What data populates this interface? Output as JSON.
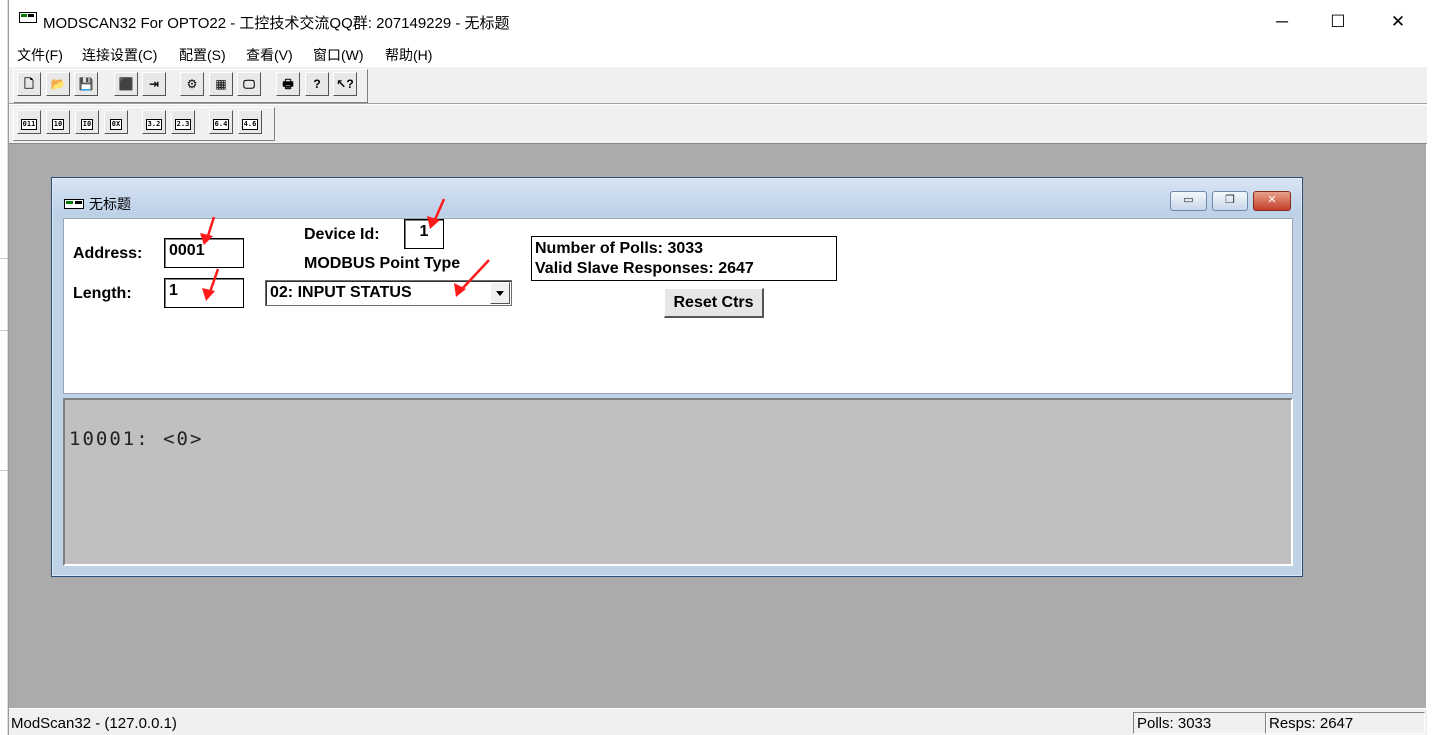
{
  "window": {
    "title": "MODSCAN32 For OPTO22 - 工控技术交流QQ群: 207149229 - 无标题",
    "minimize": "─",
    "maximize": "☐",
    "close": "✕"
  },
  "menu": [
    "文件(F)",
    "连接设置(C)",
    "配置(S)",
    "查看(V)",
    "窗口(W)",
    "帮助(H)"
  ],
  "toolbar1": [
    {
      "name": "new-file-icon",
      "glyph": "🗋"
    },
    {
      "name": "open-folder-icon",
      "glyph": "📂"
    },
    {
      "name": "save-icon",
      "glyph": "💾"
    },
    {
      "name": "connect-icon",
      "glyph": "⬛"
    },
    {
      "name": "disconnect-icon",
      "glyph": "⇥"
    },
    {
      "name": "data-definition-icon",
      "glyph": "⚙"
    },
    {
      "name": "display-icon",
      "glyph": "▦"
    },
    {
      "name": "monitor-icon",
      "glyph": "🖵"
    },
    {
      "name": "print-icon",
      "glyph": "🖶"
    },
    {
      "name": "help-icon",
      "glyph": "?"
    },
    {
      "name": "context-help-icon",
      "glyph": "↖?"
    }
  ],
  "toolbar2": [
    {
      "name": "binary-format-icon",
      "label": "011"
    },
    {
      "name": "decimal-format-icon",
      "label": "10"
    },
    {
      "name": "integer-format-icon",
      "label": "I0"
    },
    {
      "name": "hex-format-icon",
      "label": "0X"
    },
    {
      "name": "float-format-icon",
      "label": "3.2"
    },
    {
      "name": "float-swapped-format-icon",
      "label": "2.3"
    },
    {
      "name": "double-format-icon",
      "label": "6.4"
    },
    {
      "name": "double-swapped-format-icon",
      "label": "4.6"
    }
  ],
  "child": {
    "title": "无标题",
    "minimize": "▭",
    "restore": "❐",
    "close": "✕",
    "address_label": "Address:",
    "address_value": "0001",
    "length_label": "Length:",
    "length_value": "1",
    "device_label": "Device Id:",
    "device_value": "1",
    "point_type_label": "MODBUS Point Type",
    "point_type_value": "02: INPUT STATUS",
    "polls_line": "Number of Polls: 3033",
    "responses_line": "Valid Slave Responses: 2647",
    "reset_label": "Reset Ctrs",
    "data_line": "10001:  <0>"
  },
  "status": {
    "left": "ModScan32 - (127.0.0.1)",
    "polls": "Polls: 3033",
    "resps": "Resps: 2647"
  },
  "annotation_color": "#ff1a1a"
}
